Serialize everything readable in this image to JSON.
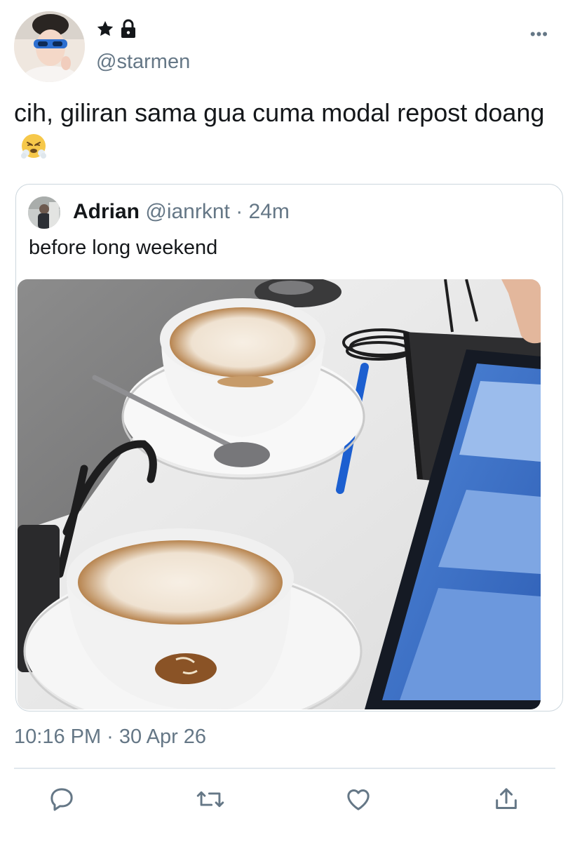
{
  "author": {
    "handle": "@starmen",
    "badges": [
      "star-icon",
      "lock-icon"
    ]
  },
  "tweet": {
    "text": "cih, giliran sama gua cuma modal repost doang",
    "emoji": "face-with-steam-from-nose",
    "timestamp": "10:16 PM · 30 Apr 26"
  },
  "quoted_tweet": {
    "name": "Adrian",
    "handle": "@ianrknt",
    "separator": "·",
    "age": "24m",
    "text": "before long weekend"
  },
  "actions": [
    "reply-icon",
    "retweet-icon",
    "like-icon",
    "share-icon"
  ],
  "colors": {
    "secondary_text": "#657786",
    "border": "#ccd6dd",
    "divider": "#e1e8ed",
    "text": "#14171a"
  }
}
